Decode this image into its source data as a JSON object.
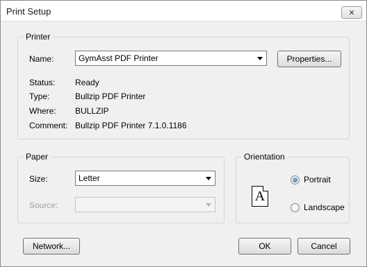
{
  "window": {
    "title": "Print Setup",
    "close_symbol": "✕"
  },
  "printer": {
    "group_label": "Printer",
    "name_label": "Name:",
    "name_value": "GymAsst PDF Printer",
    "properties_label": "Properties...",
    "status_label": "Status:",
    "status_value": "Ready",
    "type_label": "Type:",
    "type_value": "Bullzip PDF Printer",
    "where_label": "Where:",
    "where_value": "BULLZIP",
    "comment_label": "Comment:",
    "comment_value": "Bullzip PDF Printer 7.1.0.1186"
  },
  "paper": {
    "group_label": "Paper",
    "size_label": "Size:",
    "size_value": "Letter",
    "source_label": "Source:",
    "source_value": ""
  },
  "orientation": {
    "group_label": "Orientation",
    "icon_letter": "A",
    "portrait_label": "Portrait",
    "landscape_label": "Landscape",
    "selected": "Portrait"
  },
  "buttons": {
    "network": "Network...",
    "ok": "OK",
    "cancel": "Cancel"
  }
}
